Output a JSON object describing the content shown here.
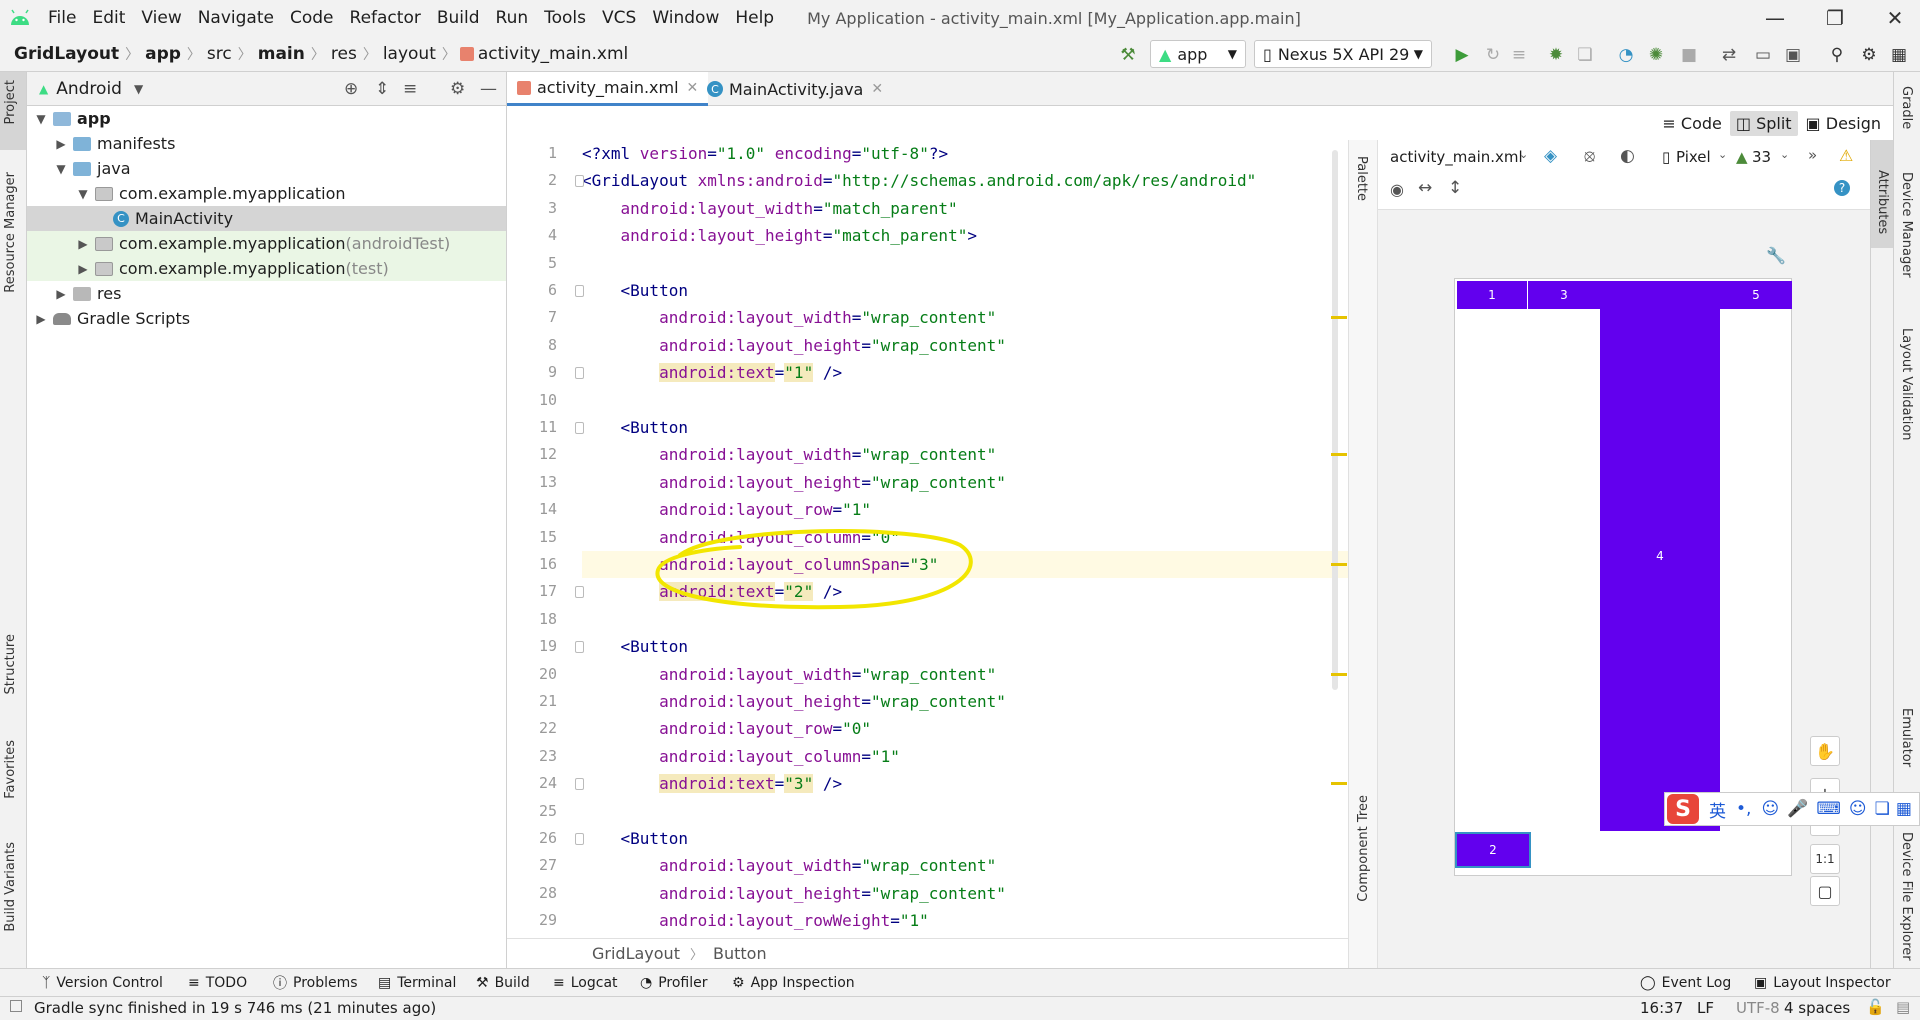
{
  "menu": {
    "items": [
      "File",
      "Edit",
      "View",
      "Navigate",
      "Code",
      "Refactor",
      "Build",
      "Run",
      "Tools",
      "VCS",
      "Window",
      "Help"
    ],
    "window_title": "My Application - activity_main.xml [My_Application.app.main]"
  },
  "nav": {
    "breadcrumbs": [
      "GridLayout",
      "app",
      "src",
      "main",
      "res",
      "layout",
      "activity_main.xml"
    ],
    "run_config": "app",
    "device": "Nexus 5X API 29"
  },
  "left_strip": {
    "project": "Project",
    "resource_manager": "Resource Manager",
    "structure": "Structure",
    "favorites": "Favorites",
    "build_variants": "Build Variants"
  },
  "right_strip": {
    "gradle": "Gradle",
    "device_manager": "Device Manager",
    "layout_validation": "Layout Validation",
    "emulator": "Emulator",
    "device_file_explorer": "Device File Explorer"
  },
  "project": {
    "view": "Android",
    "tree": [
      {
        "label": "app",
        "suffix": ""
      },
      {
        "label": "manifests",
        "suffix": ""
      },
      {
        "label": "java",
        "suffix": ""
      },
      {
        "label": "com.example.myapplication",
        "suffix": ""
      },
      {
        "label": "MainActivity",
        "suffix": ""
      },
      {
        "label": "com.example.myapplication",
        "suffix": " (androidTest)"
      },
      {
        "label": "com.example.myapplication",
        "suffix": " (test)"
      },
      {
        "label": "res",
        "suffix": ""
      },
      {
        "label": "Gradle Scripts",
        "suffix": ""
      }
    ]
  },
  "editor": {
    "tabs": [
      "activity_main.xml",
      "MainActivity.java"
    ],
    "warnings": "5",
    "view_modes": [
      "Code",
      "Split",
      "Design"
    ],
    "line_numbers": [
      "1",
      "2",
      "3",
      "4",
      "5",
      "6",
      "7",
      "8",
      "9",
      "10",
      "11",
      "12",
      "13",
      "14",
      "15",
      "16",
      "17",
      "18",
      "19",
      "20",
      "21",
      "22",
      "23",
      "24",
      "25",
      "26",
      "27",
      "28",
      "29"
    ],
    "lines": [
      {
        "n": 1,
        "indent": "",
        "parts": [
          [
            "tag",
            "<?xml "
          ],
          [
            "attr",
            "version"
          ],
          [
            "tag",
            "="
          ],
          [
            "val",
            "\"1.0\""
          ],
          [
            "tag",
            " "
          ],
          [
            "attr",
            "encoding"
          ],
          [
            "tag",
            "="
          ],
          [
            "val",
            "\"utf-8\""
          ],
          [
            "tag",
            "?>"
          ]
        ]
      },
      {
        "n": 2,
        "indent": "",
        "parts": [
          [
            "tag",
            "<GridLayout "
          ],
          [
            "attr",
            "xmlns:android"
          ],
          [
            "tag",
            "="
          ],
          [
            "val",
            "\"http://schemas.android.com/apk/res/android\""
          ]
        ]
      },
      {
        "n": 3,
        "indent": "    ",
        "parts": [
          [
            "attr",
            "android:layout_width"
          ],
          [
            "tag",
            "="
          ],
          [
            "val",
            "\"match_parent\""
          ]
        ]
      },
      {
        "n": 4,
        "indent": "    ",
        "parts": [
          [
            "attr",
            "android:layout_height"
          ],
          [
            "tag",
            "="
          ],
          [
            "val",
            "\"match_parent\""
          ],
          [
            "tag",
            ">"
          ]
        ]
      },
      {
        "n": 5,
        "indent": "",
        "parts": []
      },
      {
        "n": 6,
        "indent": "    ",
        "parts": [
          [
            "tag",
            "<Button"
          ]
        ]
      },
      {
        "n": 7,
        "indent": "        ",
        "parts": [
          [
            "attr",
            "android:layout_width"
          ],
          [
            "tag",
            "="
          ],
          [
            "val",
            "\"wrap_content\""
          ]
        ]
      },
      {
        "n": 8,
        "indent": "        ",
        "parts": [
          [
            "attr",
            "android:layout_height"
          ],
          [
            "tag",
            "="
          ],
          [
            "val",
            "\"wrap_content\""
          ]
        ]
      },
      {
        "n": 9,
        "indent": "        ",
        "parts": [
          [
            "attrhl",
            "android:text"
          ],
          [
            "tag",
            "="
          ],
          [
            "valhl",
            "\"1\""
          ],
          [
            "tag",
            " />"
          ]
        ]
      },
      {
        "n": 10,
        "indent": "",
        "parts": []
      },
      {
        "n": 11,
        "indent": "    ",
        "parts": [
          [
            "tag",
            "<Button"
          ]
        ]
      },
      {
        "n": 12,
        "indent": "        ",
        "parts": [
          [
            "attr",
            "android:layout_width"
          ],
          [
            "tag",
            "="
          ],
          [
            "val",
            "\"wrap_content\""
          ]
        ]
      },
      {
        "n": 13,
        "indent": "        ",
        "parts": [
          [
            "attr",
            "android:layout_height"
          ],
          [
            "tag",
            "="
          ],
          [
            "val",
            "\"wrap_content\""
          ]
        ]
      },
      {
        "n": 14,
        "indent": "        ",
        "parts": [
          [
            "attr",
            "android:layout_row"
          ],
          [
            "tag",
            "="
          ],
          [
            "val",
            "\"1\""
          ]
        ]
      },
      {
        "n": 15,
        "indent": "        ",
        "parts": [
          [
            "attr",
            "android:layout_column"
          ],
          [
            "tag",
            "="
          ],
          [
            "val",
            "\"0\""
          ]
        ]
      },
      {
        "n": 16,
        "indent": "        ",
        "parts": [
          [
            "attr",
            "android:layout_columnSpan"
          ],
          [
            "tag",
            "="
          ],
          [
            "val",
            "\"3\""
          ]
        ]
      },
      {
        "n": 17,
        "indent": "        ",
        "parts": [
          [
            "attrhl",
            "android:text"
          ],
          [
            "tag",
            "="
          ],
          [
            "valhl",
            "\"2\""
          ],
          [
            "tag",
            " />"
          ]
        ]
      },
      {
        "n": 18,
        "indent": "",
        "parts": []
      },
      {
        "n": 19,
        "indent": "    ",
        "parts": [
          [
            "tag",
            "<Button"
          ]
        ]
      },
      {
        "n": 20,
        "indent": "        ",
        "parts": [
          [
            "attr",
            "android:layout_width"
          ],
          [
            "tag",
            "="
          ],
          [
            "val",
            "\"wrap_content\""
          ]
        ]
      },
      {
        "n": 21,
        "indent": "        ",
        "parts": [
          [
            "attr",
            "android:layout_height"
          ],
          [
            "tag",
            "="
          ],
          [
            "val",
            "\"wrap_content\""
          ]
        ]
      },
      {
        "n": 22,
        "indent": "        ",
        "parts": [
          [
            "attr",
            "android:layout_row"
          ],
          [
            "tag",
            "="
          ],
          [
            "val",
            "\"0\""
          ]
        ]
      },
      {
        "n": 23,
        "indent": "        ",
        "parts": [
          [
            "attr",
            "android:layout_column"
          ],
          [
            "tag",
            "="
          ],
          [
            "val",
            "\"1\""
          ]
        ]
      },
      {
        "n": 24,
        "indent": "        ",
        "parts": [
          [
            "attrhl",
            "android:text"
          ],
          [
            "tag",
            "="
          ],
          [
            "valhl",
            "\"3\""
          ],
          [
            "tag",
            " />"
          ]
        ]
      },
      {
        "n": 25,
        "indent": "",
        "parts": []
      },
      {
        "n": 26,
        "indent": "    ",
        "parts": [
          [
            "tag",
            "<Button"
          ]
        ]
      },
      {
        "n": 27,
        "indent": "        ",
        "parts": [
          [
            "attr",
            "android:layout_width"
          ],
          [
            "tag",
            "="
          ],
          [
            "val",
            "\"wrap_content\""
          ]
        ]
      },
      {
        "n": 28,
        "indent": "        ",
        "parts": [
          [
            "attr",
            "android:layout_height"
          ],
          [
            "tag",
            "="
          ],
          [
            "val",
            "\"wrap_content\""
          ]
        ]
      },
      {
        "n": 29,
        "indent": "        ",
        "parts": [
          [
            "attr",
            "android:layout_rowWeight"
          ],
          [
            "tag",
            "="
          ],
          [
            "val",
            "\"1\""
          ]
        ]
      }
    ],
    "breadcrumb": [
      "GridLayout",
      "Button"
    ]
  },
  "design": {
    "file": "activity_main.xml",
    "device": "Pixel",
    "api": "33",
    "palette_label": "Palette",
    "component_tree_label": "Component Tree",
    "attributes_label": "Attributes",
    "zoom_reset": "1:1",
    "buttons": [
      "1",
      "3",
      "4",
      "5",
      "2"
    ]
  },
  "ime": {
    "logo": "S",
    "mode": "英"
  },
  "bottom_tools": [
    "Version Control",
    "TODO",
    "Problems",
    "Terminal",
    "Build",
    "Logcat",
    "Profiler",
    "App Inspection",
    "Event Log",
    "Layout Inspector"
  ],
  "status": {
    "message": "Gradle sync finished in 19 s 746 ms (21 minutes ago)",
    "position": "16:37",
    "line_sep": "LF",
    "encoding": "UTF-8",
    "indent": "4 spaces"
  },
  "colors": {
    "accent": "#6200ee",
    "annotation": "#f2e600",
    "keyword": "#000080",
    "attribute": "#871094",
    "string": "#067d17"
  }
}
